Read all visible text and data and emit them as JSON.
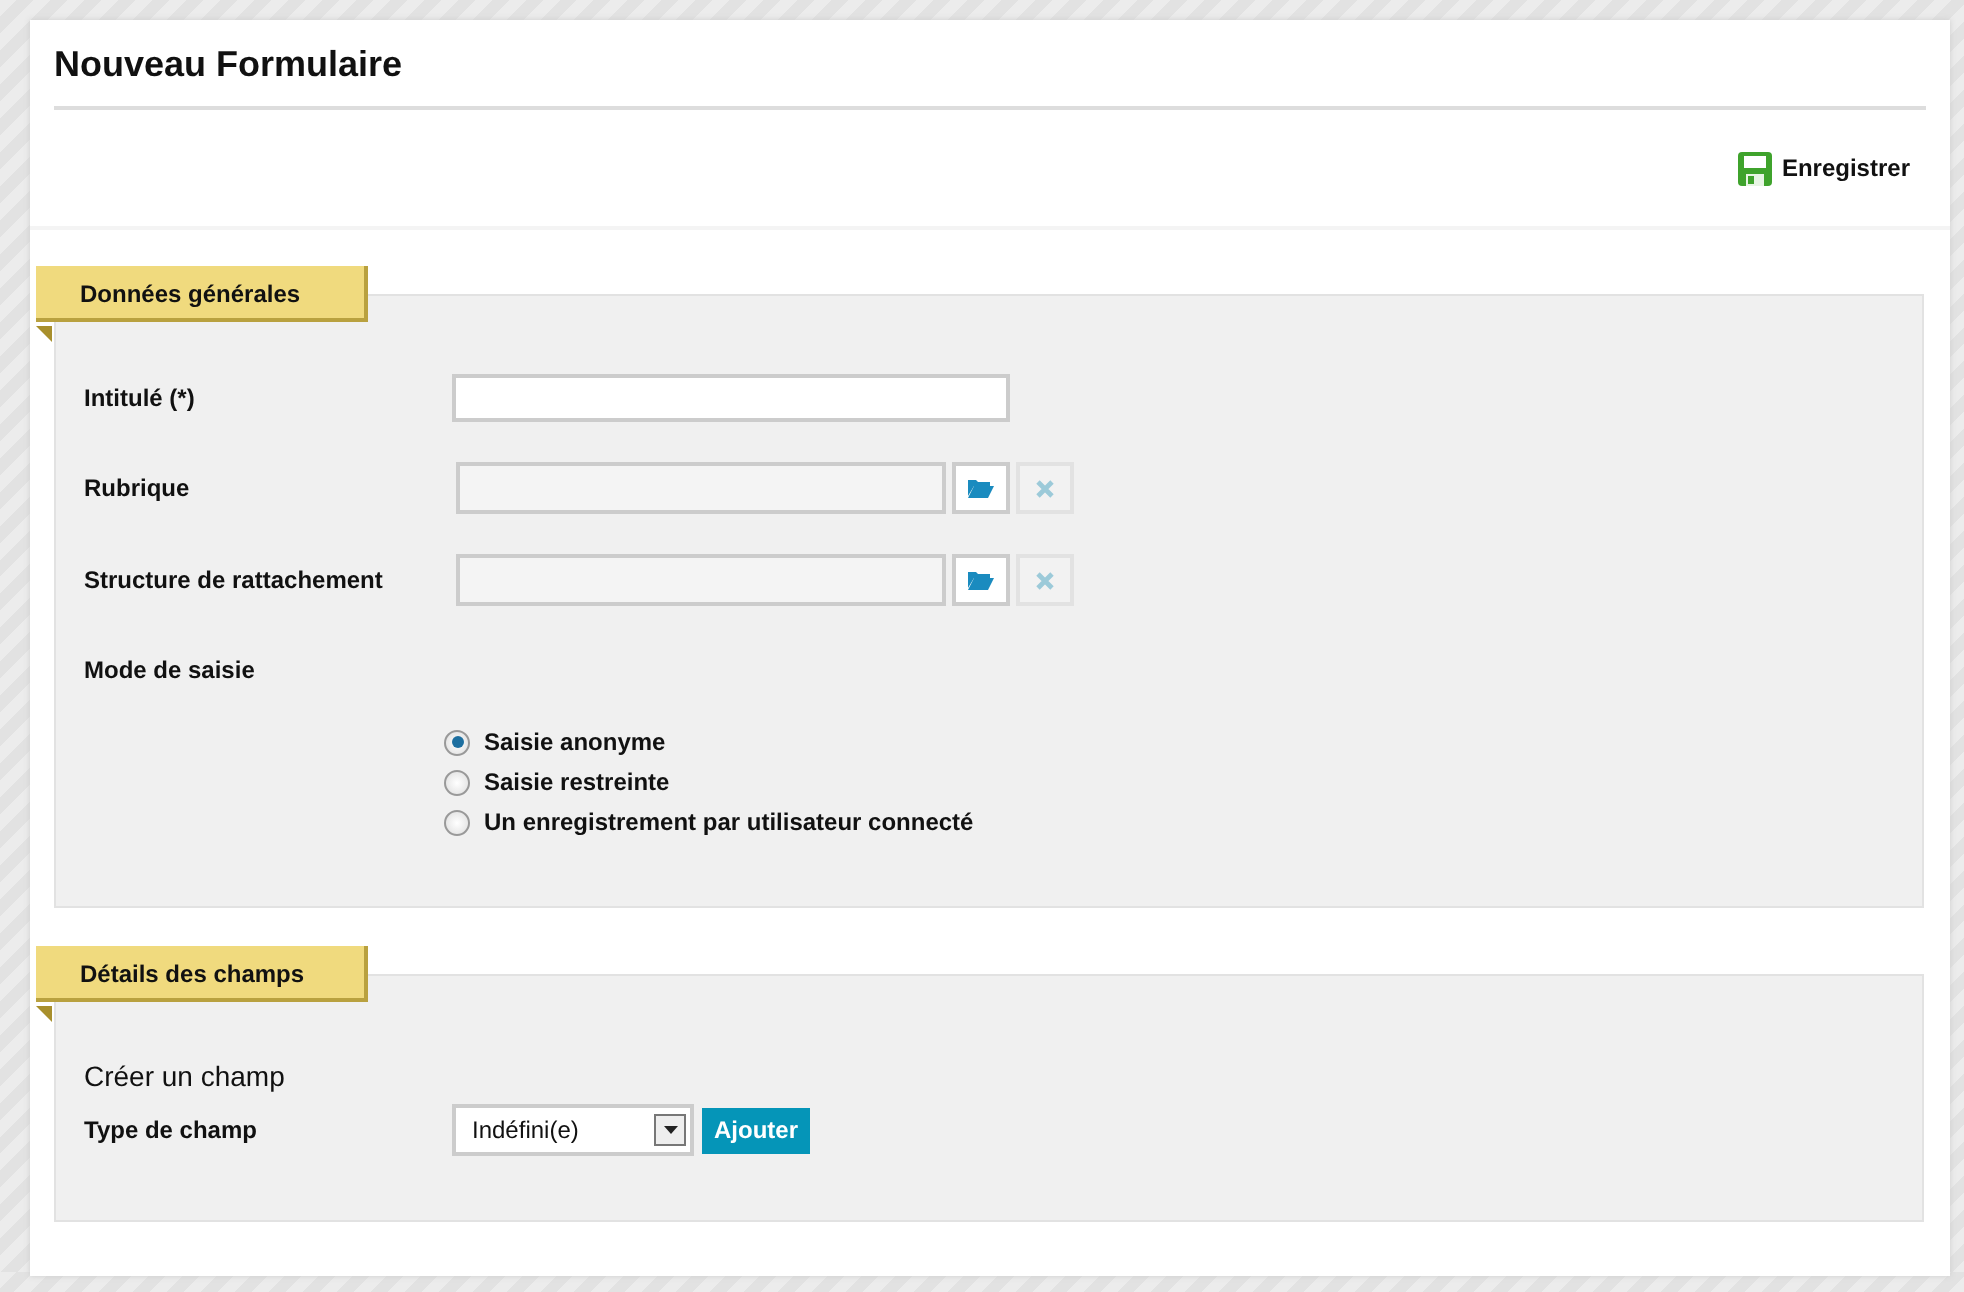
{
  "title": "Nouveau Formulaire",
  "toolbar": {
    "save_button": "Enregistrer"
  },
  "sections": [
    {
      "heading": "Données générales",
      "rows": [
        {
          "kind": "text",
          "label": "Intitulé (*)"
        },
        {
          "kind": "picker",
          "label": "Rubrique"
        },
        {
          "kind": "picker",
          "label": "Structure de rattachement"
        },
        {
          "kind": "radio_group",
          "label": "Mode de saisie",
          "options": [
            {
              "label": "Saisie anonyme",
              "selected": true
            },
            {
              "label": "Saisie restreinte",
              "selected": false
            },
            {
              "label": "Un enregistrement par utilisateur connecté",
              "selected": false
            }
          ]
        }
      ]
    },
    {
      "heading": "Détails des champs",
      "rows": [
        {
          "kind": "subtitle",
          "text": "Créer un champ"
        },
        {
          "kind": "select",
          "label": "Type de champ",
          "value": "Indéfini(e)",
          "button": "Ajouter"
        }
      ]
    }
  ]
}
